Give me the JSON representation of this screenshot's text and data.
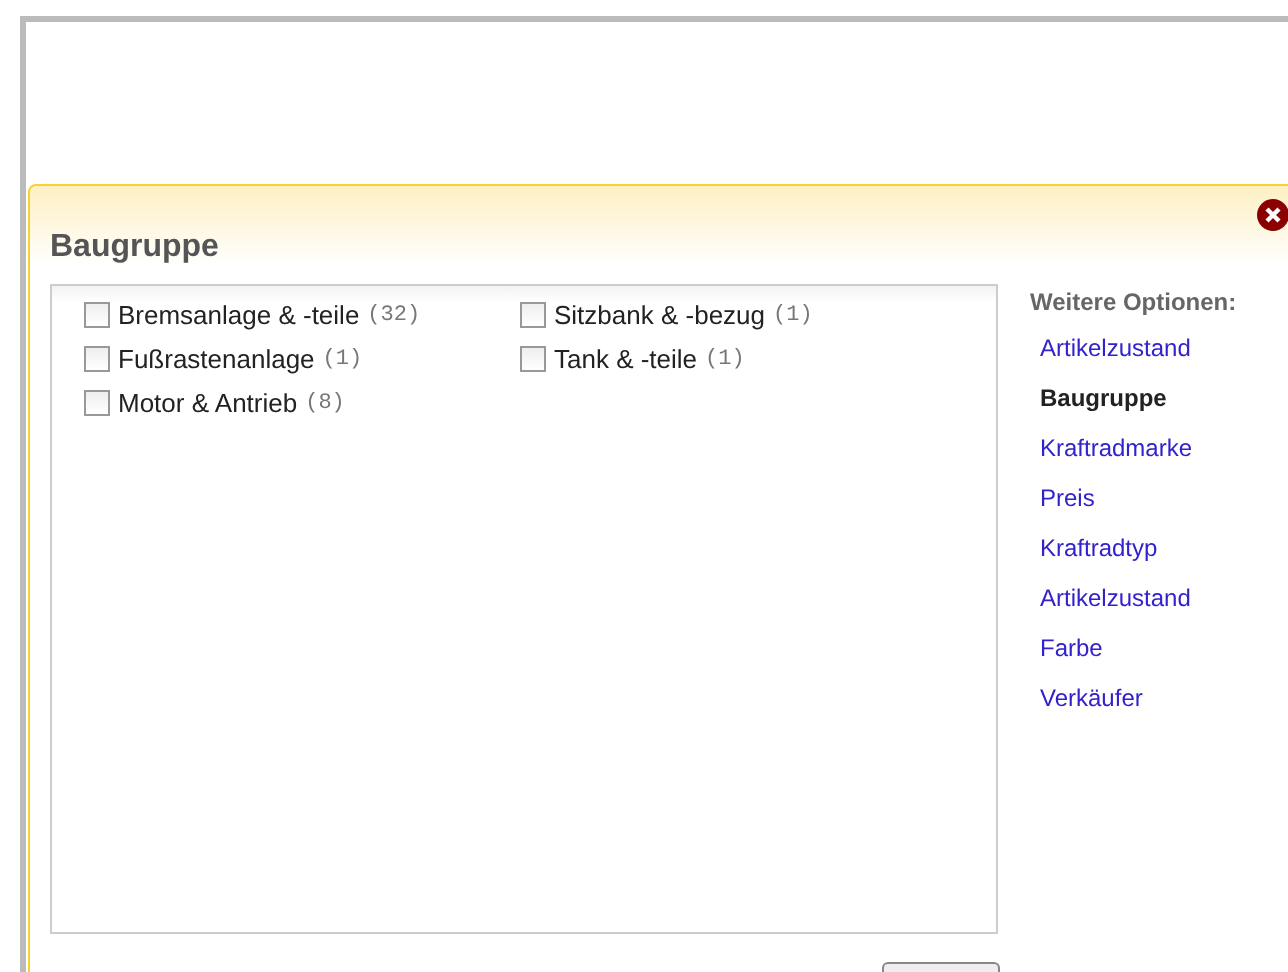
{
  "dialog": {
    "title": "Baugruppe"
  },
  "options": [
    {
      "label": "Bremsanlage & -teile",
      "count": "(32)",
      "checked": false
    },
    {
      "label": "Sitzbank & -bezug",
      "count": "(1)",
      "checked": false
    },
    {
      "label": "Fußrastenanlage",
      "count": "(1)",
      "checked": false
    },
    {
      "label": "Tank & -teile",
      "count": "(1)",
      "checked": false
    },
    {
      "label": "Motor & Antrieb",
      "count": "(8)",
      "checked": false
    }
  ],
  "sidebar": {
    "heading": "Weitere Optionen:",
    "items": [
      {
        "label": "Artikelzustand",
        "selected": false
      },
      {
        "label": "Baugruppe",
        "selected": true
      },
      {
        "label": "Kraftradmarke",
        "selected": false
      },
      {
        "label": "Preis",
        "selected": false
      },
      {
        "label": "Kraftradtyp",
        "selected": false
      },
      {
        "label": "Artikelzustand",
        "selected": false
      },
      {
        "label": "Farbe",
        "selected": false
      },
      {
        "label": "Verkäufer",
        "selected": false
      }
    ]
  }
}
